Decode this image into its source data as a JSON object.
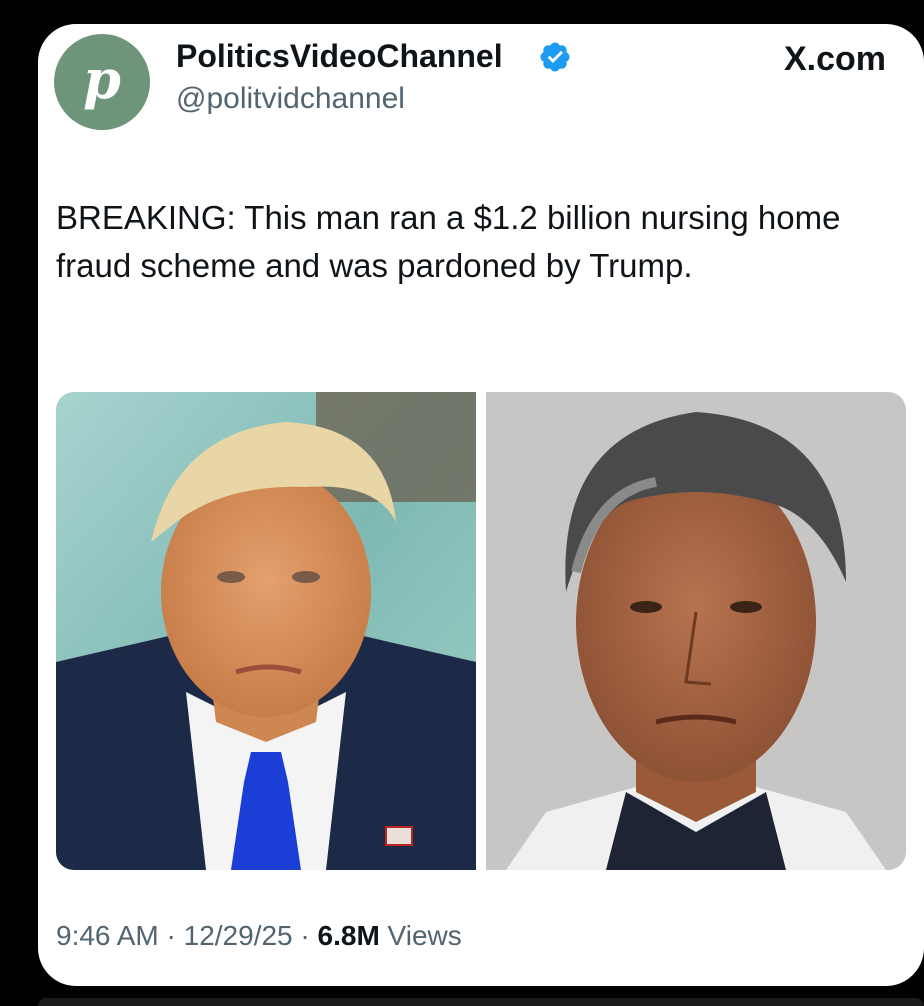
{
  "post": {
    "avatar_letter": "p",
    "display_name": "PoliticsVideoChannel",
    "handle": "@politvidchannel",
    "verified": true,
    "verified_color": "#1d9bf0",
    "brand": "X.com",
    "text": "BREAKING: This man ran a $1.2 billion nursing home fraud scheme and was pardoned by Trump.",
    "media": [
      {
        "icon": "photo-portrait-suited-man"
      },
      {
        "icon": "photo-mugshot"
      }
    ],
    "time": "9:46 AM",
    "separator": "·",
    "date": "12/29/25",
    "views_count": "6.8M",
    "views_label": "Views"
  },
  "colors": {
    "avatar_bg": "#6e9479",
    "text_primary": "#0f1419",
    "text_secondary": "#536471",
    "background": "#000000",
    "card": "#ffffff"
  }
}
